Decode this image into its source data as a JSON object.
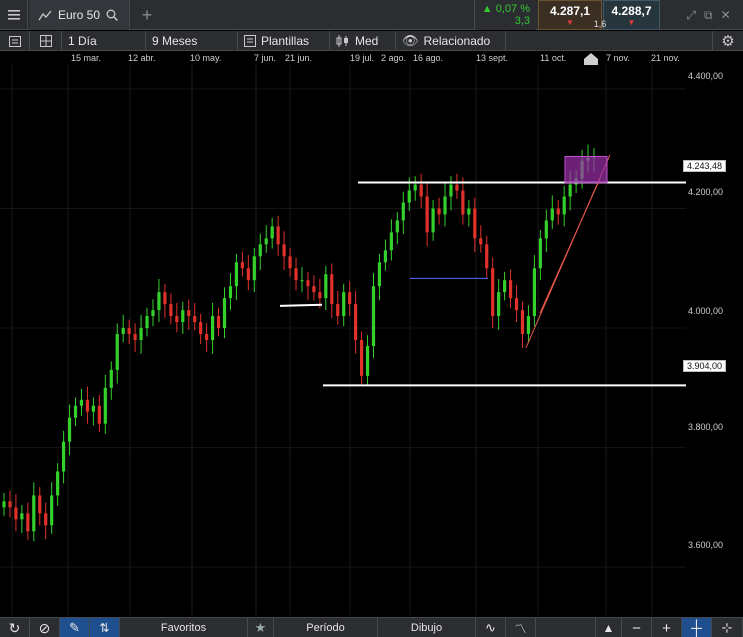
{
  "instrument": {
    "name": "Euro 50",
    "icon": "line-chart-icon"
  },
  "quote": {
    "change_pct": "0,07 %",
    "change_pts": "3,3",
    "sell": "4.287,1",
    "buy": "4.288,7",
    "spread": "1,6"
  },
  "toolbar": {
    "interval": "1 Día",
    "range": "9 Meses",
    "templates": "Plantillas",
    "chart_type": "Med",
    "related": "Relacionado"
  },
  "bottombar": {
    "favorites": "Favoritos",
    "period": "Período",
    "drawing": "Dibujo"
  },
  "colors": {
    "up": "#34d12b",
    "down": "#e0312b",
    "trend_line": "#e8584c",
    "support_line": "#4a6cff",
    "highlight_box": "#9a2fa8"
  },
  "chart_data": {
    "type": "candlestick",
    "x_tick_labels": [
      "15 mar.",
      "12 abr.",
      "10 may.",
      "7 jun.",
      "21 jun.",
      "19 jul.",
      "2 ago.",
      "16 ago.",
      "13 sept.",
      "11 oct.",
      "7 nov.",
      "21 nov."
    ],
    "y_tick_labels": [
      "4.400,00",
      "4.200,00",
      "4.000,00",
      "3.800,00",
      "3.600,00"
    ],
    "ylim": [
      3520,
      4440
    ],
    "horizontal_levels": [
      {
        "label": "4.243,48",
        "value": 4243.48
      },
      {
        "label": "3.904,00",
        "value": 3904.0
      }
    ],
    "closes": [
      3710,
      3700,
      3680,
      3690,
      3660,
      3720,
      3690,
      3670,
      3720,
      3760,
      3810,
      3850,
      3870,
      3880,
      3860,
      3870,
      3840,
      3900,
      3930,
      3990,
      4000,
      3990,
      3980,
      4000,
      4020,
      4030,
      4060,
      4040,
      4020,
      4010,
      4030,
      4020,
      4010,
      3990,
      3980,
      4020,
      4000,
      4050,
      4070,
      4110,
      4100,
      4080,
      4120,
      4140,
      4150,
      4170,
      4140,
      4120,
      4100,
      4080,
      4080,
      4070,
      4060,
      4050,
      4090,
      4040,
      4020,
      4060,
      4040,
      3980,
      3920,
      3970,
      4070,
      4110,
      4130,
      4160,
      4180,
      4210,
      4230,
      4240,
      4220,
      4160,
      4200,
      4190,
      4220,
      4240,
      4230,
      4190,
      4200,
      4150,
      4140,
      4100,
      4020,
      4060,
      4080,
      4050,
      4030,
      3990,
      4020,
      4100,
      4150,
      4180,
      4200,
      4190,
      4220,
      4240,
      4250,
      4280,
      4285,
      4287
    ]
  }
}
